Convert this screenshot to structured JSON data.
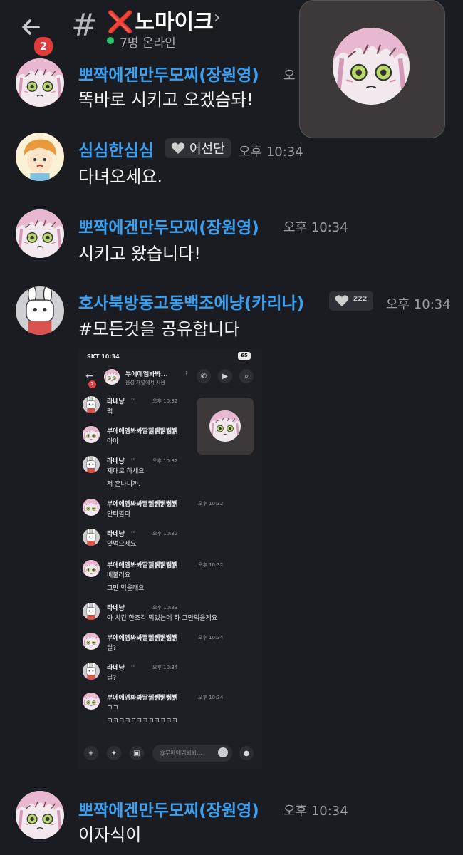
{
  "header": {
    "unread_badge": "2",
    "hash": "#",
    "channel_name": "노마이크",
    "channel_prefix_emoji": "❌",
    "chevron": "›",
    "online_status": "7명 온라인"
  },
  "messages": [
    {
      "user": "뽀짝에겐만두모찌(장원영)",
      "time": "오",
      "text": "똑바로 시키고 오겠슴돠!"
    },
    {
      "user": "심심한심심",
      "tag": "어선단",
      "time": "오후 10:34",
      "text": "다녀오세요."
    },
    {
      "user": "뽀짝에겐만두모찌(장원영)",
      "time": "오후 10:34",
      "text": "시키고 왔습니다!"
    },
    {
      "user": "호사북방동고동백조에냥(카리나)",
      "tag": "ᶻᶻᶻ",
      "time": "오후 10:34",
      "text": "#모든것을 공유합니다"
    },
    {
      "user": "뽀짝에겐만두모찌(장원영)",
      "time": "오후 10:34",
      "text": "이자식이"
    }
  ],
  "embedded": {
    "status_carrier": "SKT",
    "status_time": "10:34",
    "status_battery": "65",
    "unread_badge": "2",
    "channel_name": "부에에엠봐봐...",
    "channel_sub": "음성 채널에서 사용",
    "input_placeholder": "@부에에엠봐봐...",
    "msgs": [
      {
        "user": "라네냥",
        "tag": "ᶻᶻ",
        "time": "오후 10:32",
        "lines": [
          "퍽"
        ]
      },
      {
        "user": "부에에엠봐봐딸꿹뷁뷁뷁뷁",
        "time": "",
        "lines": [
          "아야"
        ]
      },
      {
        "user": "라네냥",
        "tag": "ᶻᶻ",
        "time": "오후 10:32",
        "lines": [
          "제대로 하세요",
          "저 혼나니까."
        ]
      },
      {
        "user": "부에에엠봐봐딸꿹뷁뷁뷁뷁",
        "time": "오후 10:32",
        "lines": [
          "안타깝다"
        ]
      },
      {
        "user": "라네냥",
        "tag": "ᶻᶻ",
        "time": "오후 10:32",
        "lines": [
          "엿먹으세요"
        ]
      },
      {
        "user": "부에에엠봐봐딸꿹뷁뷁뷁뷁",
        "time": "오후 10:32",
        "lines": [
          "배불러요",
          "그만 먹을래요"
        ]
      },
      {
        "user": "라네냥",
        "tag": "",
        "time": "오후 10:33",
        "lines": [
          "아 치킨 한조각 먹었는데 하 그만먹을게요"
        ]
      },
      {
        "user": "부에에엠봐봐딸꿹뷁뷁뷁뷁",
        "time": "오후 10:34",
        "lines": [
          "딜?"
        ]
      },
      {
        "user": "라네냥",
        "tag": "ᶻᶻ",
        "time": "오후 10:34",
        "lines": [
          "딜?"
        ]
      },
      {
        "user": "부에에엠봐봐딸꿹뷁뷁뷁뷁",
        "time": "오후 10:34",
        "lines": [
          "ㄱㄱ",
          "ㅋㅋㅋㅋㅋㅋㅋㅋㅋㅋㅋㅋ"
        ]
      }
    ]
  },
  "colors": {
    "background": "#1b1c21",
    "username": "#3aa0f2",
    "online": "#2ec26a",
    "badge": "#e23b3b"
  },
  "icons": [
    "back-arrow-icon",
    "channel-hash-icon",
    "chevron-right-icon",
    "heart-icon",
    "call-icon",
    "video-icon",
    "search-icon",
    "plus-icon",
    "apps-icon",
    "gift-icon",
    "emoji-icon",
    "mic-icon"
  ]
}
